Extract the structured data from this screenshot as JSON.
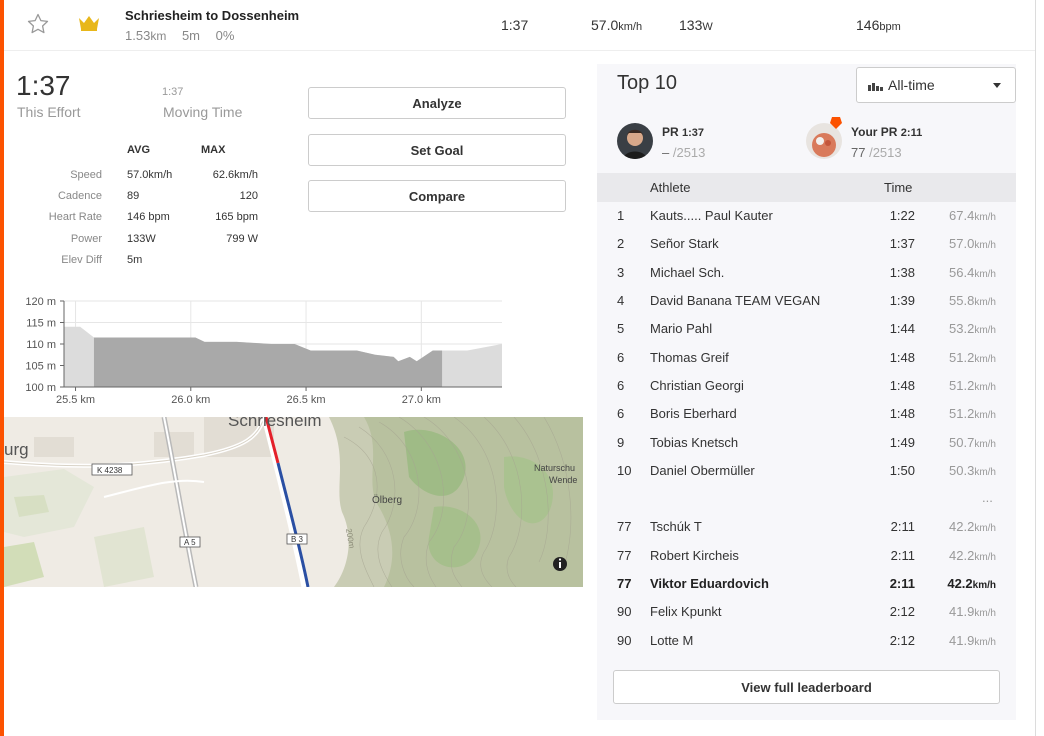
{
  "colors": {
    "accent": "#fc5200",
    "route_red": "#e4202a",
    "route_blue": "#2a4fa3",
    "crown": "#e8b71a"
  },
  "segment": {
    "name": "Schriesheim to Dossenheim",
    "distance": "1.53",
    "distance_unit": "km",
    "elev": "5m",
    "grade": "0%",
    "time": "1:37",
    "speed": "57.0",
    "speed_unit": "km/h",
    "power": "133",
    "power_unit": "W",
    "heart_rate": "146",
    "heart_rate_unit": "bpm",
    "icons": [
      "star-icon",
      "crown-icon"
    ]
  },
  "effort": {
    "time": "1:37",
    "time_label": "This Effort",
    "moving_time": "1:37",
    "moving_time_label": "Moving Time"
  },
  "actions": {
    "analyze": "Analyze",
    "set_goal": "Set Goal",
    "compare": "Compare"
  },
  "stats": {
    "headers": {
      "avg": "AVG",
      "max": "MAX"
    },
    "rows": [
      {
        "label": "Speed",
        "avg": "57.0km/h",
        "max": "62.6km/h"
      },
      {
        "label": "Cadence",
        "avg": "89",
        "max": "120"
      },
      {
        "label": "Heart Rate",
        "avg": "146 bpm",
        "max": "165 bpm"
      },
      {
        "label": "Power",
        "avg": "133W",
        "max": "799 W"
      },
      {
        "label": "Elev Diff",
        "avg": "5m",
        "max": ""
      }
    ]
  },
  "chart_data": {
    "type": "area",
    "x": [
      25.45,
      25.52,
      25.58,
      25.72,
      25.9,
      26.02,
      26.06,
      26.2,
      26.35,
      26.45,
      26.52,
      26.72,
      26.8,
      26.88,
      26.9,
      26.95,
      26.98,
      27.05,
      27.2,
      27.35
    ],
    "y": [
      114.0,
      114.0,
      111.5,
      111.5,
      111.5,
      111.5,
      110.5,
      110.5,
      110.0,
      110.0,
      108.5,
      108.5,
      107.5,
      107.0,
      106.0,
      107.0,
      106.0,
      108.5,
      108.5,
      110.0
    ],
    "highlight_x": [
      25.58,
      27.09
    ],
    "ylim": [
      100,
      120
    ],
    "xlim": [
      25.45,
      27.35
    ],
    "yticks": [
      "120 m",
      "115 m",
      "110 m",
      "105 m",
      "100 m"
    ],
    "ytick_values": [
      120,
      115,
      110,
      105,
      100
    ],
    "xticks": [
      "25.5 km",
      "26.0 km",
      "26.5 km",
      "27.0 km"
    ],
    "xtick_values": [
      25.5,
      26.0,
      26.5,
      27.0
    ],
    "grid": true
  },
  "map": {
    "labels": {
      "town": "Schriesheim",
      "left_edge": "urg",
      "road_k": "K 4238",
      "road_a": "A 5",
      "road_b": "B 3",
      "hill": "Ölberg",
      "nature1": "Naturschu",
      "nature2": "Wende",
      "contour": "200m"
    },
    "icons": [
      "info-icon"
    ]
  },
  "leaderboard": {
    "title": "Top 10",
    "filter": "All-time",
    "pr": {
      "label": "PR",
      "time": "1:37",
      "rank": "–",
      "total": "/2513"
    },
    "your_pr": {
      "label": "Your PR",
      "time": "2:11",
      "rank": "77",
      "total": "/2513"
    },
    "columns": {
      "athlete": "Athlete",
      "time": "Time"
    },
    "speed_unit": "km/h",
    "rows": [
      {
        "rank": "1",
        "name": "Kauts..... Paul Kauter",
        "time": "1:22",
        "speed": "67.4"
      },
      {
        "rank": "2",
        "name": "Señor Stark",
        "time": "1:37",
        "speed": "57.0"
      },
      {
        "rank": "3",
        "name": "Michael Sch.",
        "time": "1:38",
        "speed": "56.4"
      },
      {
        "rank": "4",
        "name": "David Banana TEAM VEGAN",
        "time": "1:39",
        "speed": "55.8"
      },
      {
        "rank": "5",
        "name": "Mario Pahl",
        "time": "1:44",
        "speed": "53.2"
      },
      {
        "rank": "6",
        "name": "Thomas Greif",
        "time": "1:48",
        "speed": "51.2"
      },
      {
        "rank": "6",
        "name": "Christian Georgi",
        "time": "1:48",
        "speed": "51.2"
      },
      {
        "rank": "6",
        "name": "Boris Eberhard",
        "time": "1:48",
        "speed": "51.2"
      },
      {
        "rank": "9",
        "name": "Tobias Knetsch",
        "time": "1:49",
        "speed": "50.7"
      },
      {
        "rank": "10",
        "name": "Daniel Obermüller",
        "time": "1:50",
        "speed": "50.3"
      }
    ],
    "ellipsis": "...",
    "nearby": [
      {
        "rank": "77",
        "name": "Tschúk T",
        "time": "2:11",
        "speed": "42.2",
        "me": false
      },
      {
        "rank": "77",
        "name": "Robert Kircheis",
        "time": "2:11",
        "speed": "42.2",
        "me": false
      },
      {
        "rank": "77",
        "name": "Viktor Eduardovich",
        "time": "2:11",
        "speed": "42.2",
        "me": true
      },
      {
        "rank": "90",
        "name": "Felix Kpunkt",
        "time": "2:12",
        "speed": "41.9",
        "me": false
      },
      {
        "rank": "90",
        "name": "Lotte M",
        "time": "2:12",
        "speed": "41.9",
        "me": false
      }
    ],
    "full_button": "View full leaderboard"
  }
}
